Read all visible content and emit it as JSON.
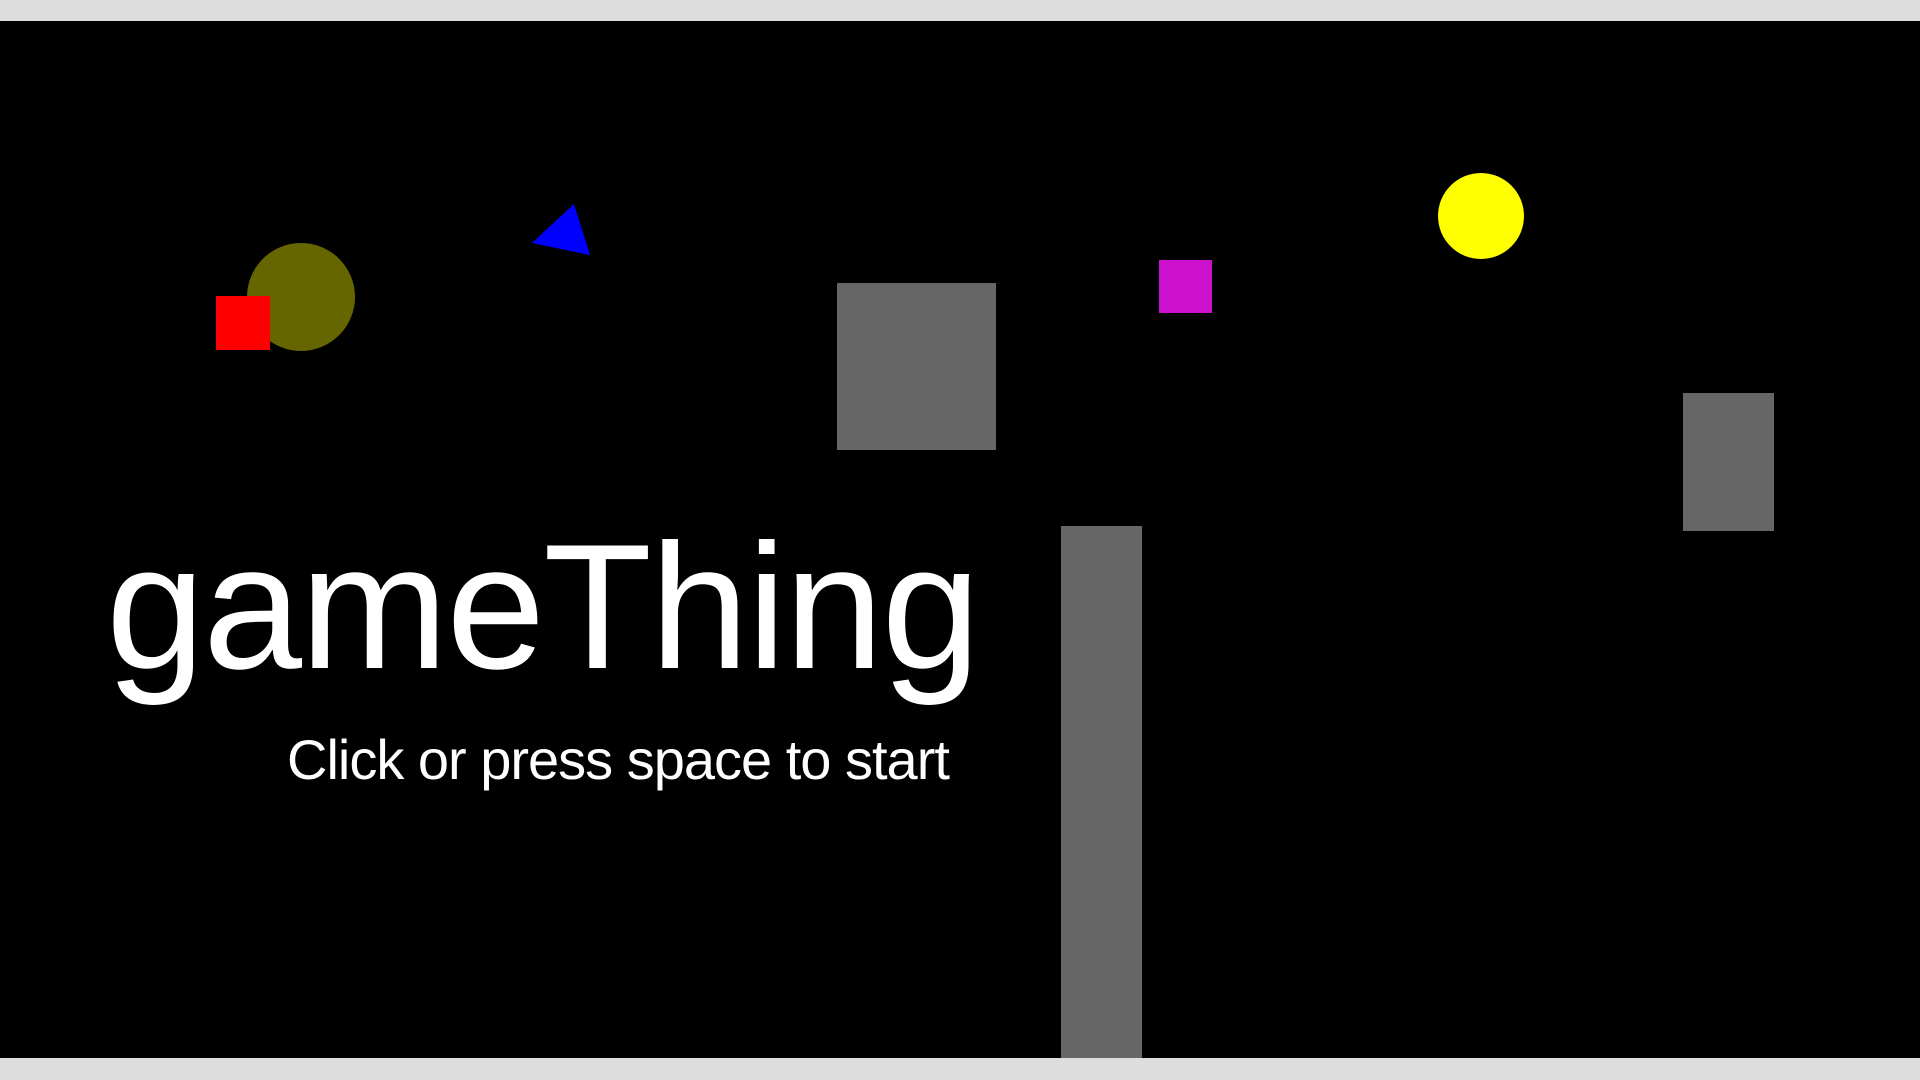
{
  "game": {
    "title": "gameThing",
    "subtitle": "Click or press space to start",
    "colors": {
      "background": "#000000",
      "frame": "#dddddd",
      "platform": "#666666",
      "player": "#ff0000",
      "enemy_circle": "#666600",
      "triangle": "#0000ff",
      "pickup_square": "#cc11cc",
      "sun_circle": "#ffff00",
      "text": "#ffffff"
    },
    "objects": [
      {
        "name": "olive-circle",
        "shape": "circle"
      },
      {
        "name": "red-square-player",
        "shape": "rect"
      },
      {
        "name": "blue-triangle",
        "shape": "triangle"
      },
      {
        "name": "magenta-square",
        "shape": "rect"
      },
      {
        "name": "yellow-circle",
        "shape": "circle"
      },
      {
        "name": "gray-block-upper",
        "shape": "rect"
      },
      {
        "name": "gray-block-right",
        "shape": "rect"
      },
      {
        "name": "gray-pillar",
        "shape": "rect"
      }
    ]
  }
}
